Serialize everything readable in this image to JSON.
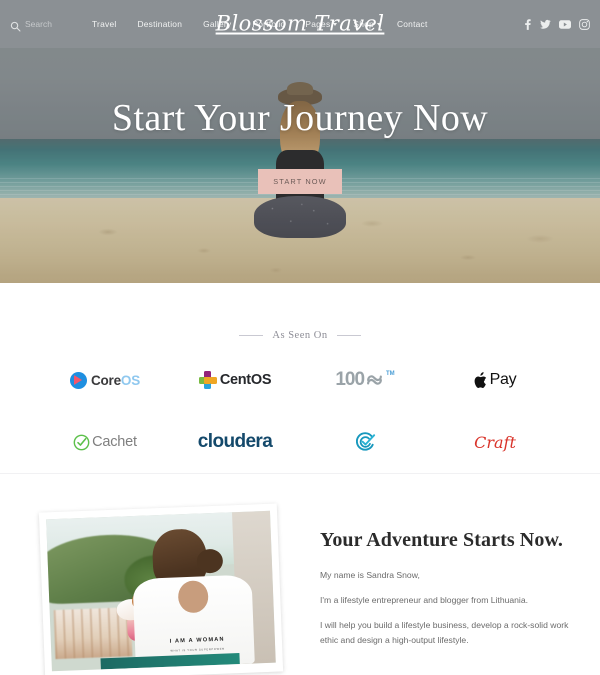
{
  "header": {
    "search": {
      "placeholder": "Search",
      "value": "",
      "icon": "search-icon"
    },
    "nav_left": [
      {
        "label": "Travel",
        "has_caret": false
      },
      {
        "label": "Destination",
        "has_caret": false
      },
      {
        "label": "Gallery",
        "has_caret": false
      },
      {
        "label": "Portfolio",
        "has_caret": false
      }
    ],
    "brand": "Blossom Travel",
    "nav_right": [
      {
        "label": "Pages",
        "has_caret": true
      },
      {
        "label": "Shop",
        "has_caret": true
      },
      {
        "label": "Contact",
        "has_caret": false
      }
    ],
    "social": [
      {
        "name": "facebook-icon",
        "label": "Facebook"
      },
      {
        "name": "twitter-icon",
        "label": "Twitter"
      },
      {
        "name": "youtube-icon",
        "label": "YouTube"
      },
      {
        "name": "instagram-icon",
        "label": "Instagram"
      }
    ],
    "background_color": "#8b9094",
    "text_color": "#f2f3f3"
  },
  "hero": {
    "title": "Start Your Journey Now",
    "button_label": "START NOW",
    "button_color": "#e9c1b9",
    "button_text_color": "#6d5c58"
  },
  "as_seen_on": {
    "heading": "As Seen On",
    "logos": [
      {
        "name": "coreos-logo",
        "text_primary": "Core",
        "text_secondary": "OS",
        "color": "#1f8fe0"
      },
      {
        "name": "centos-logo",
        "text": "CentOS",
        "color": "#26282c"
      },
      {
        "name": "hundred-logo",
        "text": "100",
        "superscript": "TM",
        "color": "#9aa3a8"
      },
      {
        "name": "apple-pay-logo",
        "text": "Pay",
        "color": "#111111"
      },
      {
        "name": "cachet-logo",
        "text": "Cachet",
        "color": "#7f7f7f",
        "mark_color": "#5cc04a"
      },
      {
        "name": "cloudera-logo",
        "text": "cloudera",
        "color": "#14496b"
      },
      {
        "name": "check-circle-logo",
        "text": "",
        "color": "#1798bd"
      },
      {
        "name": "craft-logo",
        "text": "Craft",
        "color": "#d9342b"
      }
    ]
  },
  "adventure": {
    "title": "Your Adventure Starts Now.",
    "paragraphs": [
      "My name is Sandra Snow,",
      "I'm a lifestyle entrepreneur and blogger from Lithuania.",
      "I will help you build a lifestyle business, develop a rock-solid work ethic and design a high-output lifestyle."
    ],
    "photo": {
      "name": "sandra-photo",
      "shirt_text_main": "I AM A WOMAN",
      "shirt_text_sub": "WHAT IS YOUR SUPERPOWER"
    }
  }
}
